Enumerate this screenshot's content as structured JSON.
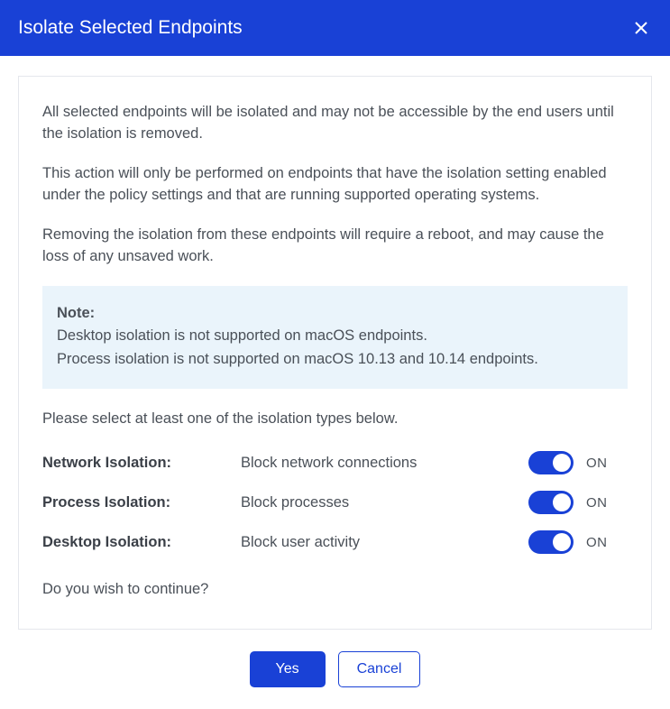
{
  "header": {
    "title": "Isolate Selected Endpoints"
  },
  "body": {
    "para1": "All selected endpoints will be isolated and may not be accessible by the end users until the isolation is removed.",
    "para2": "This action will only be performed on endpoints that have the isolation setting enabled under the policy settings and that are running supported operating systems.",
    "para3": "Removing the isolation from these endpoints will require a reboot, and may cause the loss of any unsaved work.",
    "note_label": "Note:",
    "note_line1": "Desktop isolation is not supported on macOS endpoints.",
    "note_line2": "Process isolation is not supported on macOS 10.13 and 10.14 endpoints.",
    "select_prompt": "Please select at least one of the isolation types below.",
    "toggles": [
      {
        "label": "Network Isolation:",
        "desc": "Block network connections",
        "state": "ON"
      },
      {
        "label": "Process Isolation:",
        "desc": "Block processes",
        "state": "ON"
      },
      {
        "label": "Desktop Isolation:",
        "desc": "Block user activity",
        "state": "ON"
      }
    ],
    "continue_q": "Do you wish to continue?"
  },
  "footer": {
    "yes": "Yes",
    "cancel": "Cancel"
  }
}
